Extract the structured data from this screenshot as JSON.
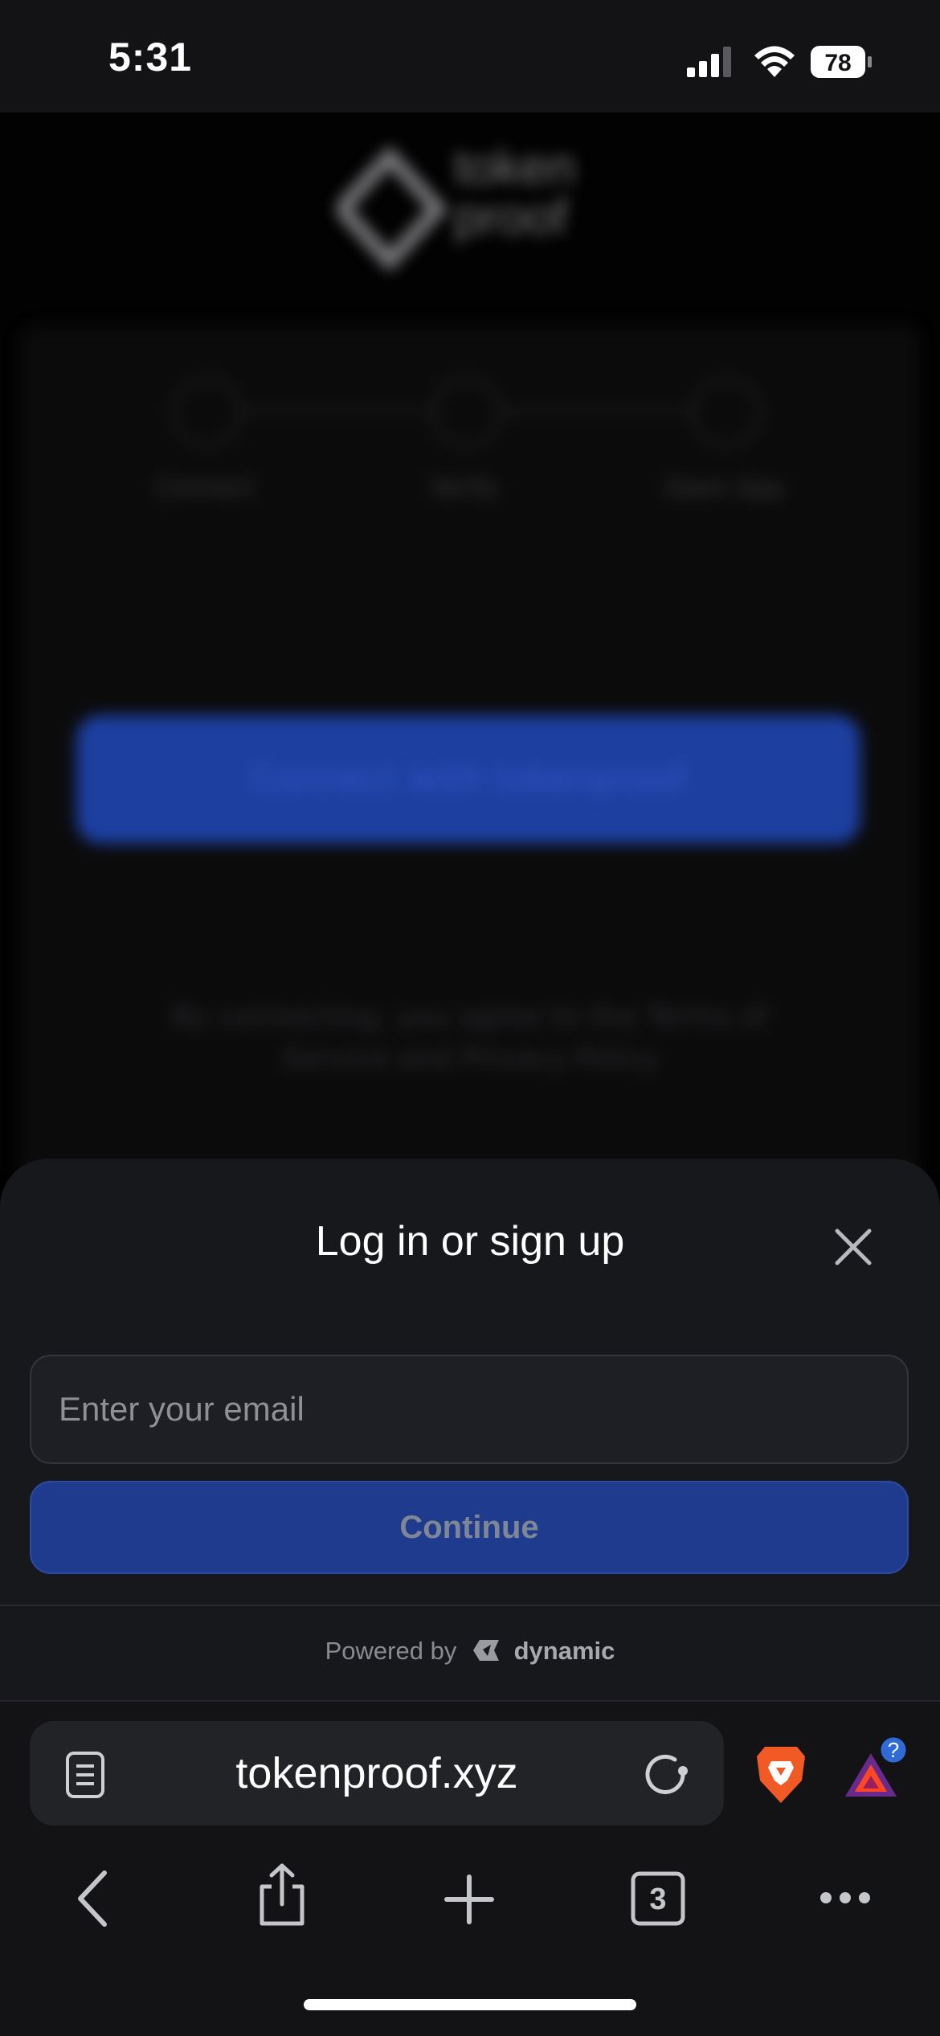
{
  "status_bar": {
    "time": "5:31",
    "battery": "78"
  },
  "background_page": {
    "logo_text_line1": "token",
    "logo_text_line2": "proof",
    "steps": [
      "Connect",
      "Verify",
      "Open App"
    ],
    "connect_button": "Connect with tokenproof",
    "terms": "By connecting, you agree to the Terms of Service and Privacy Policy"
  },
  "sheet": {
    "title": "Log in or sign up",
    "email_placeholder": "Enter your email",
    "continue_label": "Continue",
    "powered_by": "Powered by",
    "brand": "dynamic"
  },
  "browser": {
    "url": "tokenproof.xyz",
    "tab_count": "3",
    "notification_badge": "?"
  },
  "colors": {
    "accent": "#1f3b8e",
    "sheet_bg": "#17181c",
    "brave": "#f15a24"
  }
}
